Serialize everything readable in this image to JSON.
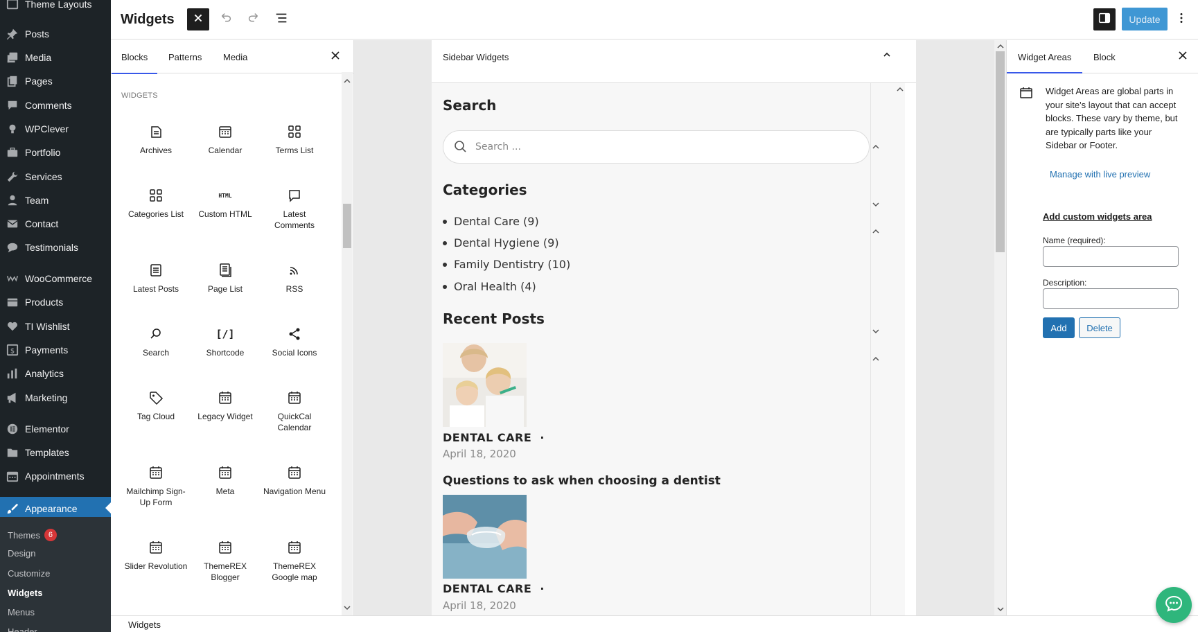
{
  "admin_menu": [
    {
      "label": "Theme Layouts",
      "icon": "layout-icon"
    },
    {
      "label": "Posts",
      "icon": "pin-icon"
    },
    {
      "label": "Media",
      "icon": "media-icon"
    },
    {
      "label": "Pages",
      "icon": "pages-icon"
    },
    {
      "label": "Comments",
      "icon": "comment-icon"
    },
    {
      "label": "WPClever",
      "icon": "bulb-icon"
    },
    {
      "label": "Portfolio",
      "icon": "portfolio-icon"
    },
    {
      "label": "Services",
      "icon": "wrench-icon"
    },
    {
      "label": "Team",
      "icon": "person-icon"
    },
    {
      "label": "Contact",
      "icon": "mail-icon"
    },
    {
      "label": "Testimonials",
      "icon": "speech-icon"
    },
    {
      "label": "WooCommerce",
      "icon": "woo-icon"
    },
    {
      "label": "Products",
      "icon": "box-icon"
    },
    {
      "label": "TI Wishlist",
      "icon": "heart-icon"
    },
    {
      "label": "Payments",
      "icon": "dollar-icon"
    },
    {
      "label": "Analytics",
      "icon": "bars-icon"
    },
    {
      "label": "Marketing",
      "icon": "megaphone-icon"
    },
    {
      "label": "Elementor",
      "icon": "elementor-icon"
    },
    {
      "label": "Templates",
      "icon": "folder-icon"
    },
    {
      "label": "Appointments",
      "icon": "calendar-icon"
    },
    {
      "label": "Appearance",
      "icon": "brush-icon"
    }
  ],
  "appearance_submenu": [
    {
      "label": "Themes",
      "badge": "6"
    },
    {
      "label": "Design"
    },
    {
      "label": "Customize"
    },
    {
      "label": "Widgets"
    },
    {
      "label": "Menus"
    },
    {
      "label": "Header"
    }
  ],
  "header": {
    "title": "Widgets",
    "update_label": "Update"
  },
  "inserter": {
    "tabs": [
      "Blocks",
      "Patterns",
      "Media"
    ],
    "category": "WIDGETS",
    "blocks": [
      {
        "label": "Archives",
        "icon": "archive-icon"
      },
      {
        "label": "Calendar",
        "icon": "calendar-icon"
      },
      {
        "label": "Terms List",
        "icon": "grid-icon"
      },
      {
        "label": "Categories List",
        "icon": "grid-icon"
      },
      {
        "label": "Custom HTML",
        "icon": "html-icon",
        "glyph": "HTML"
      },
      {
        "label": "Latest Comments",
        "icon": "comment-icon"
      },
      {
        "label": "Latest Posts",
        "icon": "list-icon"
      },
      {
        "label": "Page List",
        "icon": "page-list-icon"
      },
      {
        "label": "RSS",
        "icon": "rss-icon"
      },
      {
        "label": "Search",
        "icon": "search-icon"
      },
      {
        "label": "Shortcode",
        "icon": "shortcode-icon",
        "glyph": "[/]"
      },
      {
        "label": "Social Icons",
        "icon": "share-icon"
      },
      {
        "label": "Tag Cloud",
        "icon": "tag-icon"
      },
      {
        "label": "Legacy Widget",
        "icon": "widget-icon"
      },
      {
        "label": "QuickCal Calendar",
        "icon": "widget-icon"
      },
      {
        "label": "Mailchimp Sign-Up Form",
        "icon": "widget-icon"
      },
      {
        "label": "Meta",
        "icon": "widget-icon"
      },
      {
        "label": "Navigation Menu",
        "icon": "widget-icon"
      },
      {
        "label": "Slider Revolution",
        "icon": "widget-icon"
      },
      {
        "label": "ThemeREX Blogger",
        "icon": "widget-icon"
      },
      {
        "label": "ThemeREX Google map",
        "icon": "widget-icon"
      }
    ]
  },
  "widget_area": {
    "title": "Sidebar Widgets",
    "search": {
      "heading": "Search",
      "placeholder": "Search ..."
    },
    "categories": {
      "heading": "Categories",
      "items": [
        "Dental Care (9)",
        "Dental Hygiene (9)",
        "Family Dentistry (10)",
        "Oral Health (4)"
      ]
    },
    "recent": {
      "heading": "Recent Posts",
      "posts": [
        {
          "category": "DENTAL CARE",
          "date": "April 18, 2020",
          "title": ""
        },
        {
          "category": "DENTAL CARE",
          "date": "April 18, 2020",
          "title": "Questions to ask when choosing a dentist"
        }
      ]
    }
  },
  "settings": {
    "tabs": [
      "Widget Areas",
      "Block"
    ],
    "description": "Widget Areas are global parts in your site's layout that can accept blocks. These vary by theme, but are typically parts like your Sidebar or Footer.",
    "manage_link": "Manage with live preview",
    "custom_heading": "Add custom widgets area",
    "name_label": "Name (required):",
    "description_label": "Description:",
    "add_label": "Add",
    "delete_label": "Delete"
  },
  "footer": {
    "breadcrumb": "Widgets"
  },
  "colors": {
    "admin_bg": "#1d2327",
    "active": "#2271b1",
    "accent": "#3858e9",
    "update": "#3f97d4",
    "chat": "#2fb67c"
  }
}
